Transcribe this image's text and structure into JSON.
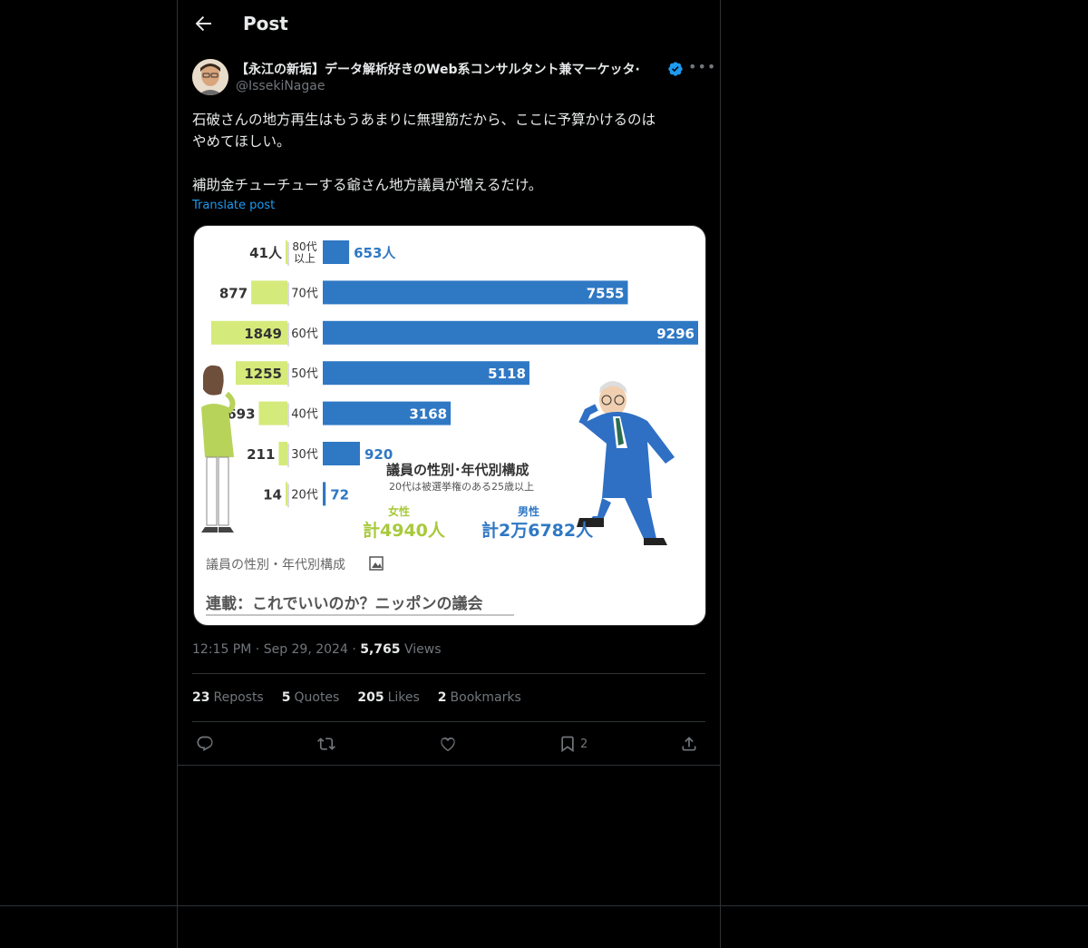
{
  "header": {
    "title": "Post"
  },
  "author": {
    "name": "【永江の新垢】データ解析好きのWeb系コンサルタント兼マーケッタ·",
    "handle": "@IssekiNagae",
    "verified_color": "#1d9bf0"
  },
  "tweet": {
    "text": "石破さんの地方再生はもうあまりに無理筋だから、ここに予算かけるのは\nやめてほしい。\n\n補助金チューチューする爺さん地方議員が増えるだけ。",
    "translate_label": "Translate post"
  },
  "meta": {
    "time": "12:15 PM",
    "date": "Sep 29, 2024",
    "views_count": "5,765",
    "views_label": "Views"
  },
  "stats": [
    {
      "count": "23",
      "label": "Reposts"
    },
    {
      "count": "5",
      "label": "Quotes"
    },
    {
      "count": "205",
      "label": "Likes"
    },
    {
      "count": "2",
      "label": "Bookmarks"
    }
  ],
  "actions": {
    "bookmark_count": "2"
  },
  "media": {
    "caption": "議員の性別・年代別構成",
    "link_text": "連載：これでいいのか？ニッポンの議会"
  },
  "chart_data": {
    "type": "bar",
    "title": "議員の性別･年代別構成",
    "subtitle": "20代は被選挙権のある25歳以上",
    "categories": [
      "80代\n以上",
      "70代",
      "60代",
      "50代",
      "40代",
      "30代",
      "20代"
    ],
    "series": [
      {
        "name": "女性",
        "values": [
          41,
          877,
          1849,
          1255,
          693,
          211,
          14
        ],
        "color": "#d4ea7a",
        "labels": [
          "41人",
          "877",
          "1849",
          "1255",
          "693",
          "211",
          "14"
        ]
      },
      {
        "name": "男性",
        "values": [
          653,
          7555,
          9296,
          5118,
          3168,
          920,
          72
        ],
        "color": "#2f78c4",
        "labels": [
          "653人",
          "7555",
          "9296",
          "5118",
          "3168",
          "920",
          "72"
        ]
      }
    ],
    "totals": {
      "female_label": "女性",
      "female_total": "計4940人",
      "male_label": "男性",
      "male_total": "計2万6782人"
    }
  }
}
